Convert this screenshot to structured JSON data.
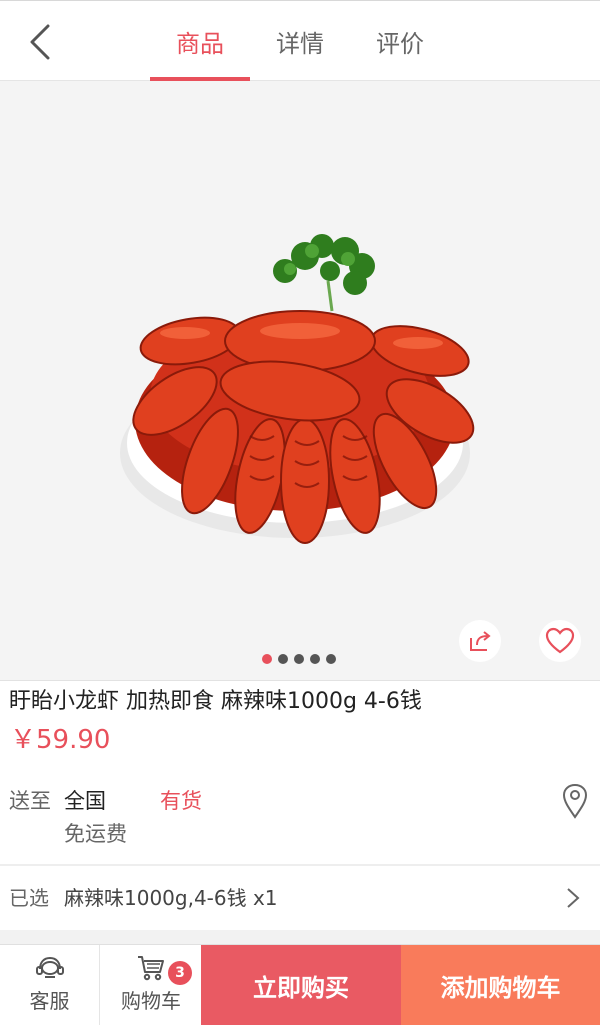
{
  "header": {
    "back_icon": "chevron-left-icon",
    "tabs": [
      {
        "label": "商品",
        "active": true
      },
      {
        "label": "详情",
        "active": false
      },
      {
        "label": "评价",
        "active": false
      }
    ]
  },
  "gallery": {
    "image_subject": "crayfish-dish",
    "share_icon": "share-icon",
    "favorite_icon": "heart-icon",
    "total_images": 5,
    "current_index": 1
  },
  "product": {
    "title": "盱眙小龙虾 加热即食 麻辣味1000g 4-6钱",
    "price": "￥59.90"
  },
  "shipping": {
    "label": "送至",
    "region": "全国",
    "fee": "免运费",
    "stock": "有货",
    "location_icon": "location-pin-icon"
  },
  "selection": {
    "label": "已选",
    "value": "麻辣味1000g,4-6钱 x1"
  },
  "bottom_bar": {
    "service_label": "客服",
    "cart_label": "购物车",
    "cart_count": "3",
    "buy_now": "立即购买",
    "add_to_cart": "添加购物车"
  },
  "colors": {
    "accent": "#e8505b",
    "buy_now_bg": "#e95a63",
    "add_cart_bg": "#f97b5b"
  }
}
